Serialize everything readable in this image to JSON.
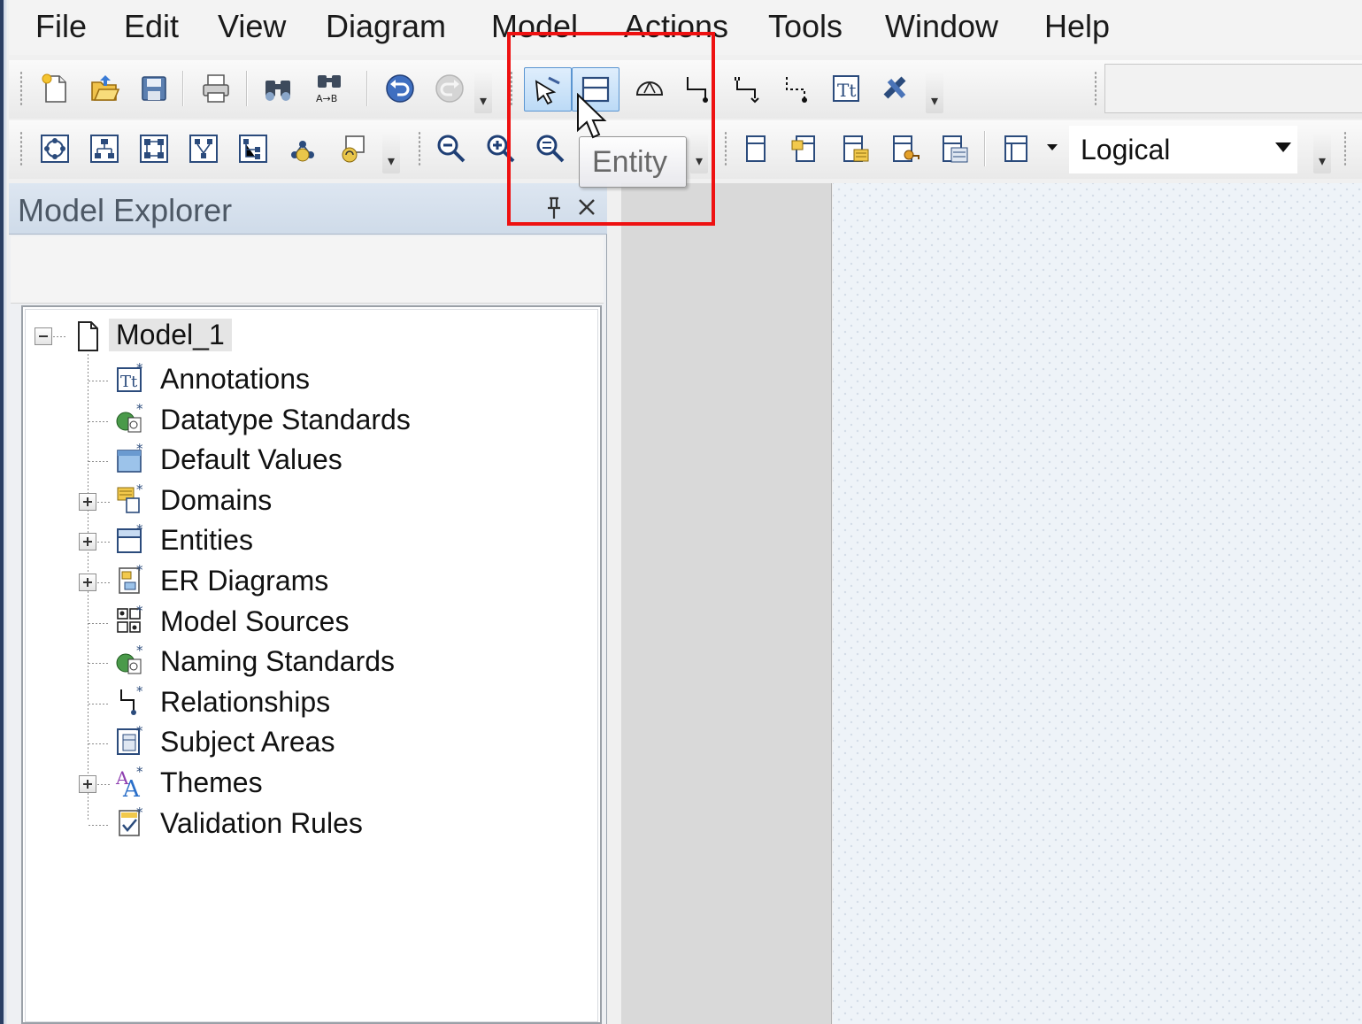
{
  "menu": [
    "File",
    "Edit",
    "View",
    "Diagram",
    "Model",
    "Actions",
    "Tools",
    "Window",
    "Help"
  ],
  "toolbar1": {
    "buttons": [
      {
        "icon": "new-model-icon"
      },
      {
        "icon": "open-icon"
      },
      {
        "icon": "save-icon"
      },
      {
        "icon": "print-icon"
      },
      {
        "icon": "find-icon"
      },
      {
        "icon": "find-replace-icon"
      },
      {
        "icon": "undo-icon"
      },
      {
        "icon": "redo-icon"
      },
      {
        "icon": "pointer-select-icon",
        "active": true
      },
      {
        "icon": "entity-icon",
        "active": true
      },
      {
        "icon": "subtype-icon"
      },
      {
        "icon": "identifying-relationship-icon"
      },
      {
        "icon": "many-to-many-relationship-icon"
      },
      {
        "icon": "non-identifying-relationship-icon"
      },
      {
        "icon": "text-block-icon"
      },
      {
        "icon": "drawing-object-icon"
      }
    ]
  },
  "toolbar2": {
    "buttons": [
      {
        "icon": "layout-circular-icon"
      },
      {
        "icon": "layout-hierarchical-icon"
      },
      {
        "icon": "layout-orthogonal-icon"
      },
      {
        "icon": "layout-tree-icon"
      },
      {
        "icon": "layout-tree-alt-icon"
      },
      {
        "icon": "model-refresh-icon"
      },
      {
        "icon": "diagram-refresh-icon"
      },
      {
        "icon": "zoom-out-icon"
      },
      {
        "icon": "zoom-in-icon"
      },
      {
        "icon": "zoom-fit-icon"
      },
      {
        "icon": "entity-display-icon"
      },
      {
        "icon": "entity-attributes-icon"
      },
      {
        "icon": "entity-keys-icon"
      },
      {
        "icon": "entity-fk-icon"
      },
      {
        "icon": "entity-full-icon"
      },
      {
        "icon": "display-level-icon"
      }
    ],
    "model_view": "Logical"
  },
  "tooltip": "Entity",
  "highlight_color": "#ee1111",
  "explorer": {
    "title": "Model Explorer",
    "root": "Model_1",
    "items": [
      {
        "label": "Annotations",
        "icon": "annotation-icon",
        "expandable": false
      },
      {
        "label": "Datatype Standards",
        "icon": "datatype-standards-icon",
        "expandable": false
      },
      {
        "label": "Default Values",
        "icon": "default-values-icon",
        "expandable": false
      },
      {
        "label": "Domains",
        "icon": "domains-icon",
        "expandable": true
      },
      {
        "label": "Entities",
        "icon": "entities-icon",
        "expandable": true
      },
      {
        "label": "ER Diagrams",
        "icon": "er-diagrams-icon",
        "expandable": true
      },
      {
        "label": "Model Sources",
        "icon": "model-sources-icon",
        "expandable": false
      },
      {
        "label": "Naming Standards",
        "icon": "naming-standards-icon",
        "expandable": false
      },
      {
        "label": "Relationships",
        "icon": "relationships-icon",
        "expandable": false
      },
      {
        "label": "Subject Areas",
        "icon": "subject-areas-icon",
        "expandable": false
      },
      {
        "label": "Themes",
        "icon": "themes-icon",
        "expandable": true
      },
      {
        "label": "Validation Rules",
        "icon": "validation-rules-icon",
        "expandable": false
      }
    ]
  }
}
